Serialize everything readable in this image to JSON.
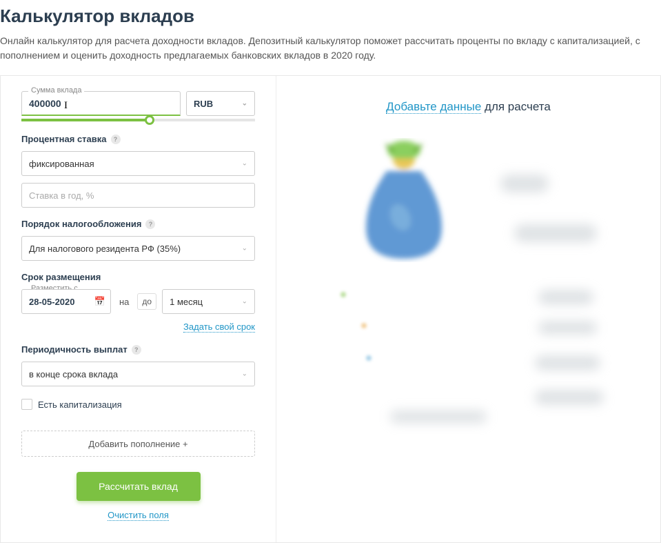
{
  "page": {
    "title": "Калькулятор вкладов",
    "description": "Онлайн калькулятор для расчета доходности вкладов. Депозитный калькулятор поможет рассчитать проценты по вкладу с капитализацией, с пополнением и оценить доходность предлагаемых банковских вкладов в 2020 году."
  },
  "amount": {
    "label": "Сумма вклада",
    "value": "400000",
    "currency": "RUB"
  },
  "rate": {
    "section_label": "Процентная ставка",
    "type_value": "фиксированная",
    "input_placeholder": "Ставка в год, %"
  },
  "tax": {
    "section_label": "Порядок налогообложения",
    "value": "Для налогового резидента РФ (35%)"
  },
  "term": {
    "section_label": "Срок размещения",
    "date_label": "Разместить с",
    "date_value": "28-05-2020",
    "na_text": "на",
    "do_text": "до",
    "period_value": "1 месяц",
    "custom_link": "Задать свой срок"
  },
  "payout": {
    "section_label": "Периодичность выплат",
    "value": "в конце срока вклада"
  },
  "capitalization": {
    "label": "Есть капитализация"
  },
  "buttons": {
    "add_deposit": "Добавить пополнение +",
    "calculate": "Рассчитать вклад",
    "clear": "Очистить поля"
  },
  "result": {
    "title_link": "Добавьте данные",
    "title_rest": " для расчета"
  }
}
